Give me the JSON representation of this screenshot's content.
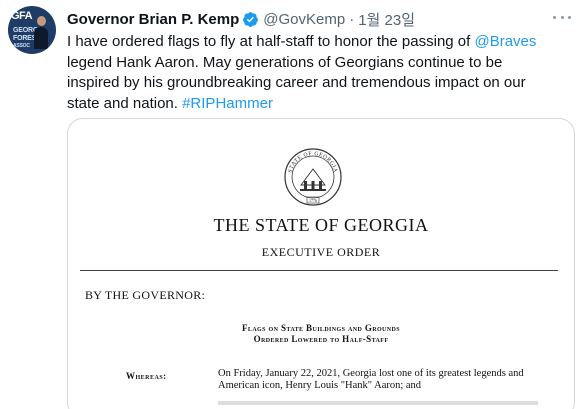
{
  "tweet": {
    "avatar": {
      "abbr": "GFA",
      "line1": "GEORGIA",
      "line2": "FOREST",
      "line3": "ASSOC"
    },
    "author_name": "Governor Brian P. Kemp",
    "handle": "@GovKemp",
    "separator": "·",
    "date": "1월 23일",
    "text_part1": "I have ordered flags to fly at half-staff to honor the passing of ",
    "mention": "@Braves",
    "text_part2": " legend Hank Aaron. May generations of Georgians continue to be inspired by his groundbreaking career and tremendous impact on our state and nation. ",
    "hashtag": "#RIPHammer"
  },
  "document": {
    "seal_text": "STATE OF GEORGIA",
    "seal_year": "1776",
    "title": "THE STATE OF GEORGIA",
    "subtitle": "EXECUTIVE ORDER",
    "byline": "BY THE GOVERNOR:",
    "order_title_line1": "Flags on State Buildings and Grounds",
    "order_title_line2": "Ordered Lowered to Half-Staff",
    "whereas_label": "Whereas:",
    "whereas_text": "On Friday, January 22, 2021, Georgia lost one of its greatest legends and American icon, Henry Louis \"Hank\" Aaron; and"
  },
  "colors": {
    "link": "#1d9bf0",
    "verified": "#1d9bf0",
    "secondary_text": "#536471"
  },
  "icons": {
    "verified": "verified-badge-icon",
    "more": "more-options-icon"
  }
}
